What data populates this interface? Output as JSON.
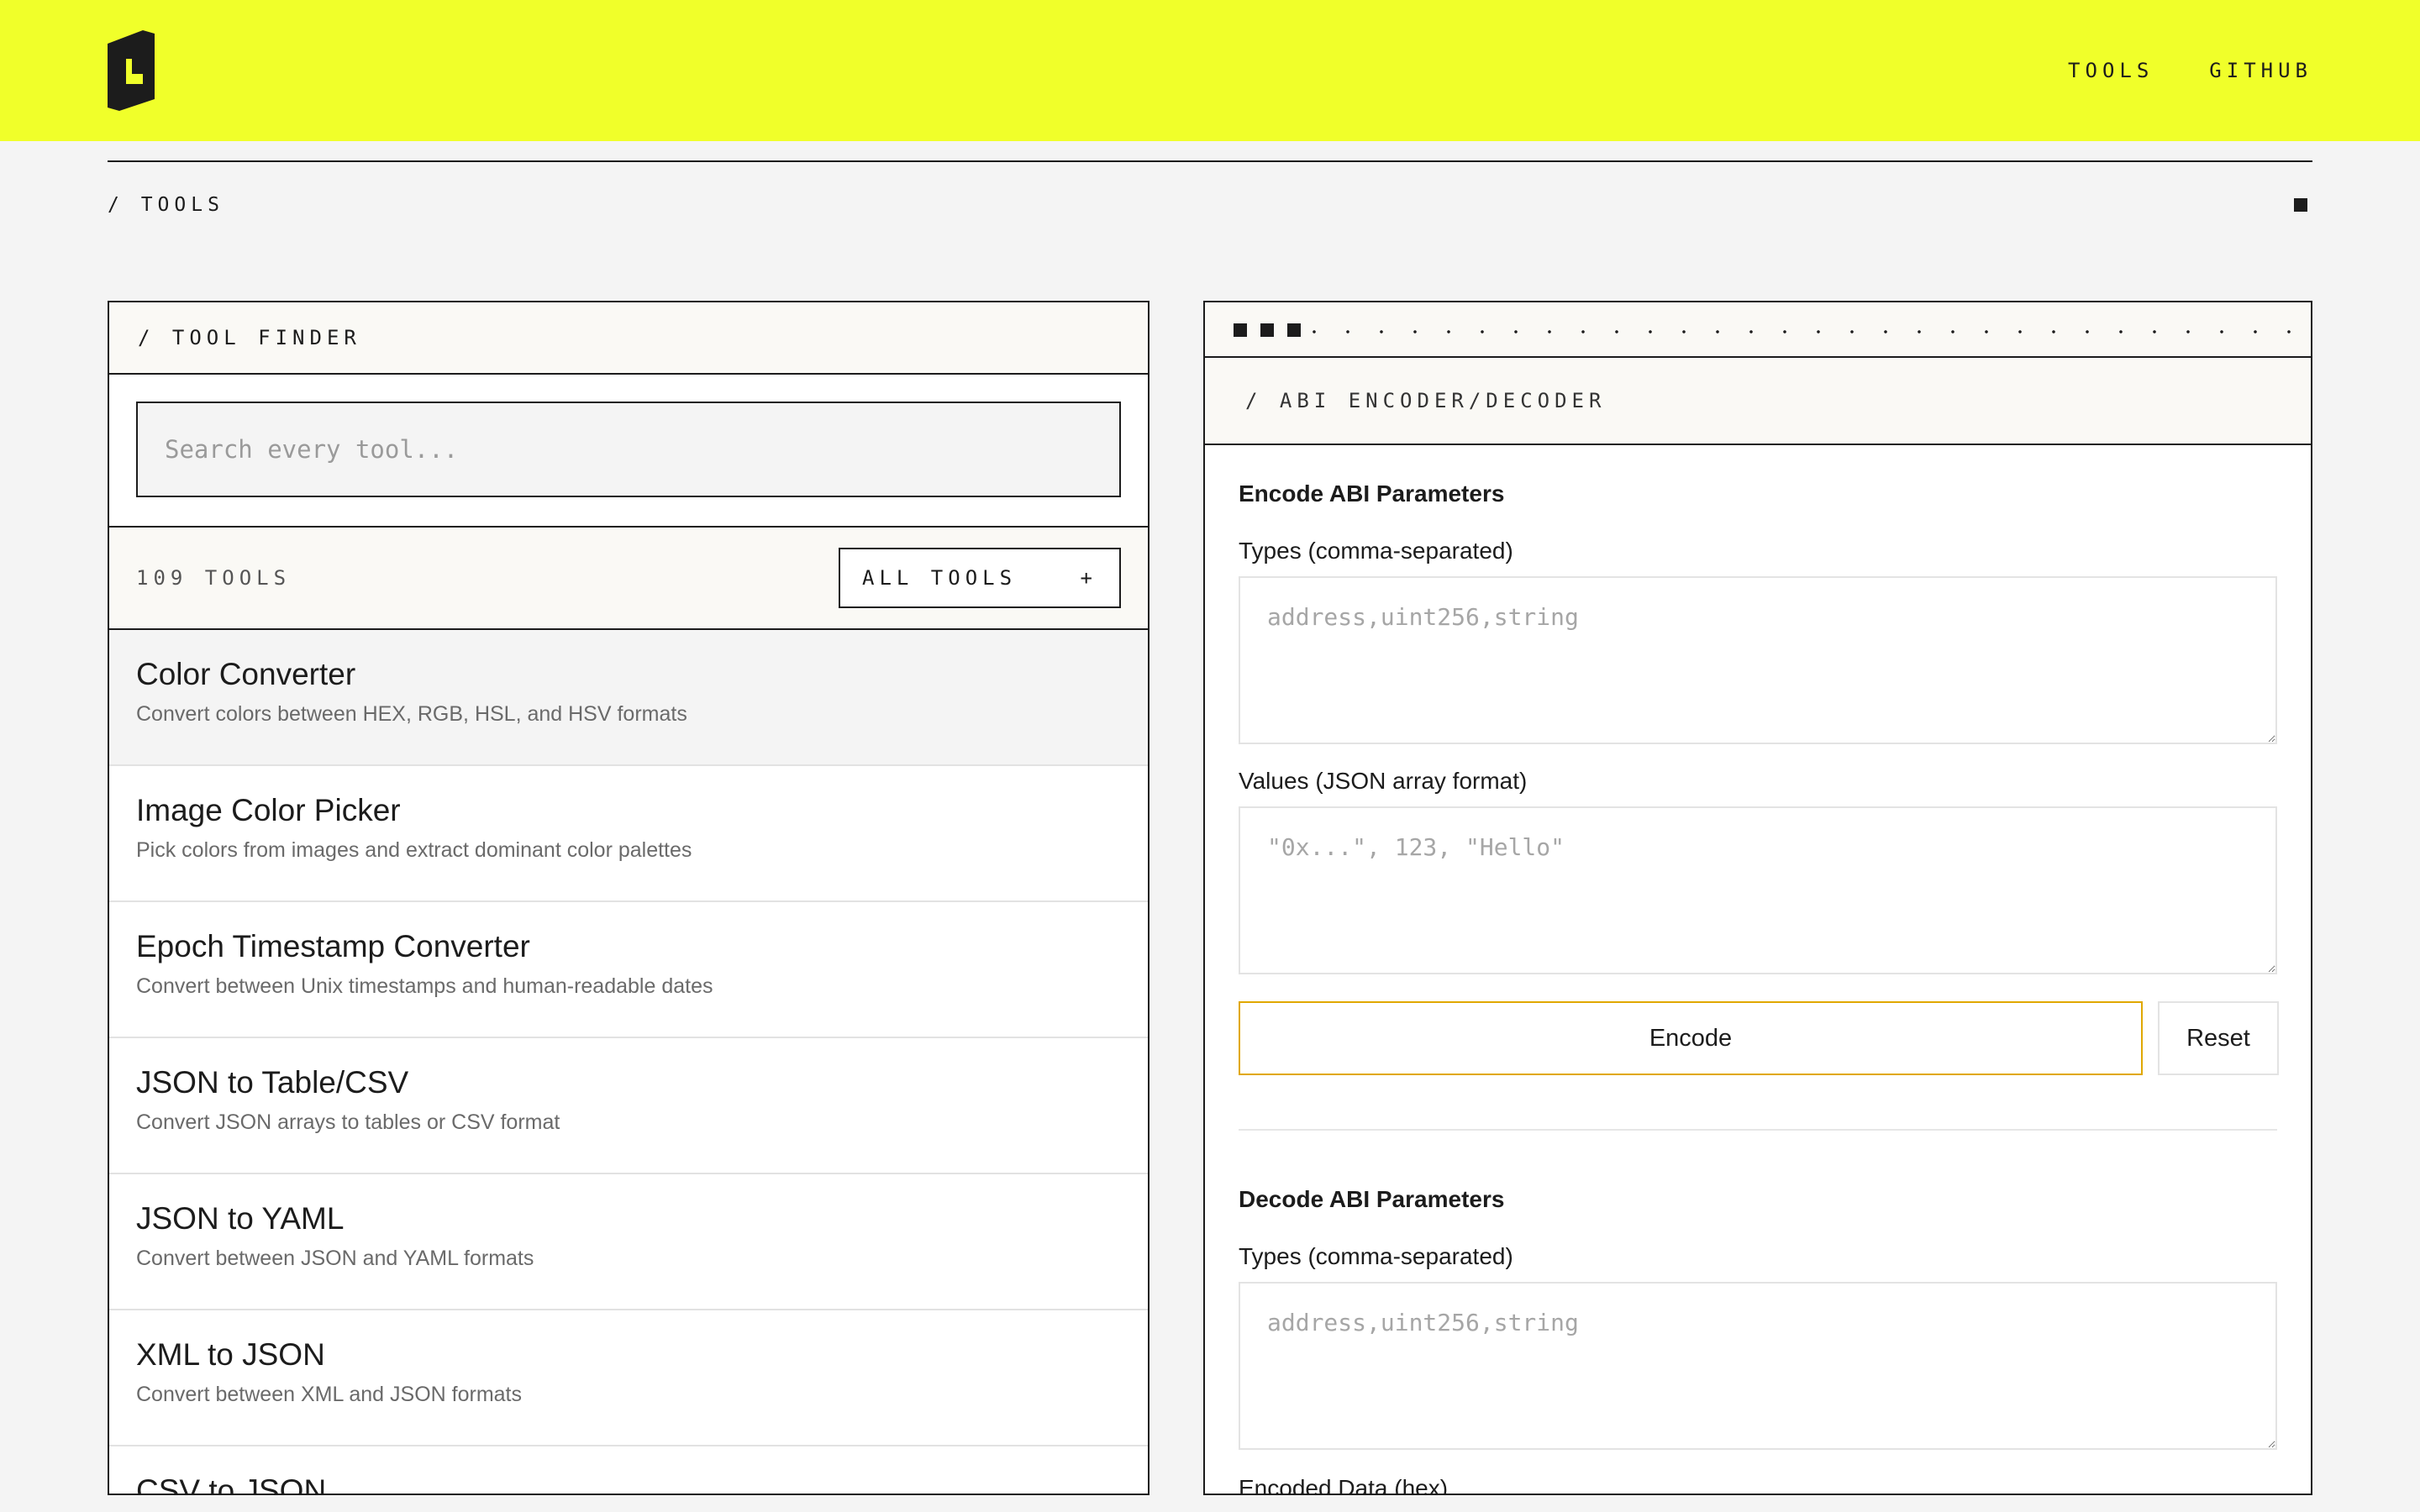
{
  "header": {
    "nav": [
      "TOOLS",
      "GITHUB"
    ]
  },
  "breadcrumb": "/ TOOLS",
  "finder": {
    "title": "/ TOOL FINDER",
    "search_placeholder": "Search every tool...",
    "count": "109 TOOLS",
    "filter_label": "ALL TOOLS",
    "filter_icon": "+",
    "tools": [
      {
        "name": "Color Converter",
        "desc": "Convert colors between HEX, RGB, HSL, and HSV formats"
      },
      {
        "name": "Image Color Picker",
        "desc": "Pick colors from images and extract dominant color palettes"
      },
      {
        "name": "Epoch Timestamp Converter",
        "desc": "Convert between Unix timestamps and human-readable dates"
      },
      {
        "name": "JSON to Table/CSV",
        "desc": "Convert JSON arrays to tables or CSV format"
      },
      {
        "name": "JSON to YAML",
        "desc": "Convert between JSON and YAML formats"
      },
      {
        "name": "XML to JSON",
        "desc": "Convert between XML and JSON formats"
      },
      {
        "name": "CSV to JSON",
        "desc": ""
      }
    ]
  },
  "tool": {
    "title": "/ ABI ENCODER/DECODER",
    "encode": {
      "heading": "Encode ABI Parameters",
      "types_label": "Types (comma-separated)",
      "types_placeholder": "address,uint256,string",
      "values_label": "Values (JSON array format)",
      "values_placeholder": "\"0x...\", 123, \"Hello\"",
      "encode_button": "Encode",
      "reset_button": "Reset"
    },
    "decode": {
      "heading": "Decode ABI Parameters",
      "types_label": "Types (comma-separated)",
      "types_placeholder": "address,uint256,string",
      "data_label": "Encoded Data (hex)"
    }
  },
  "colors": {
    "header_bg": "#f0ff2a",
    "ink": "#1c1c1c",
    "accent_border": "#e0a800",
    "page_bg": "#f4f4f4"
  }
}
